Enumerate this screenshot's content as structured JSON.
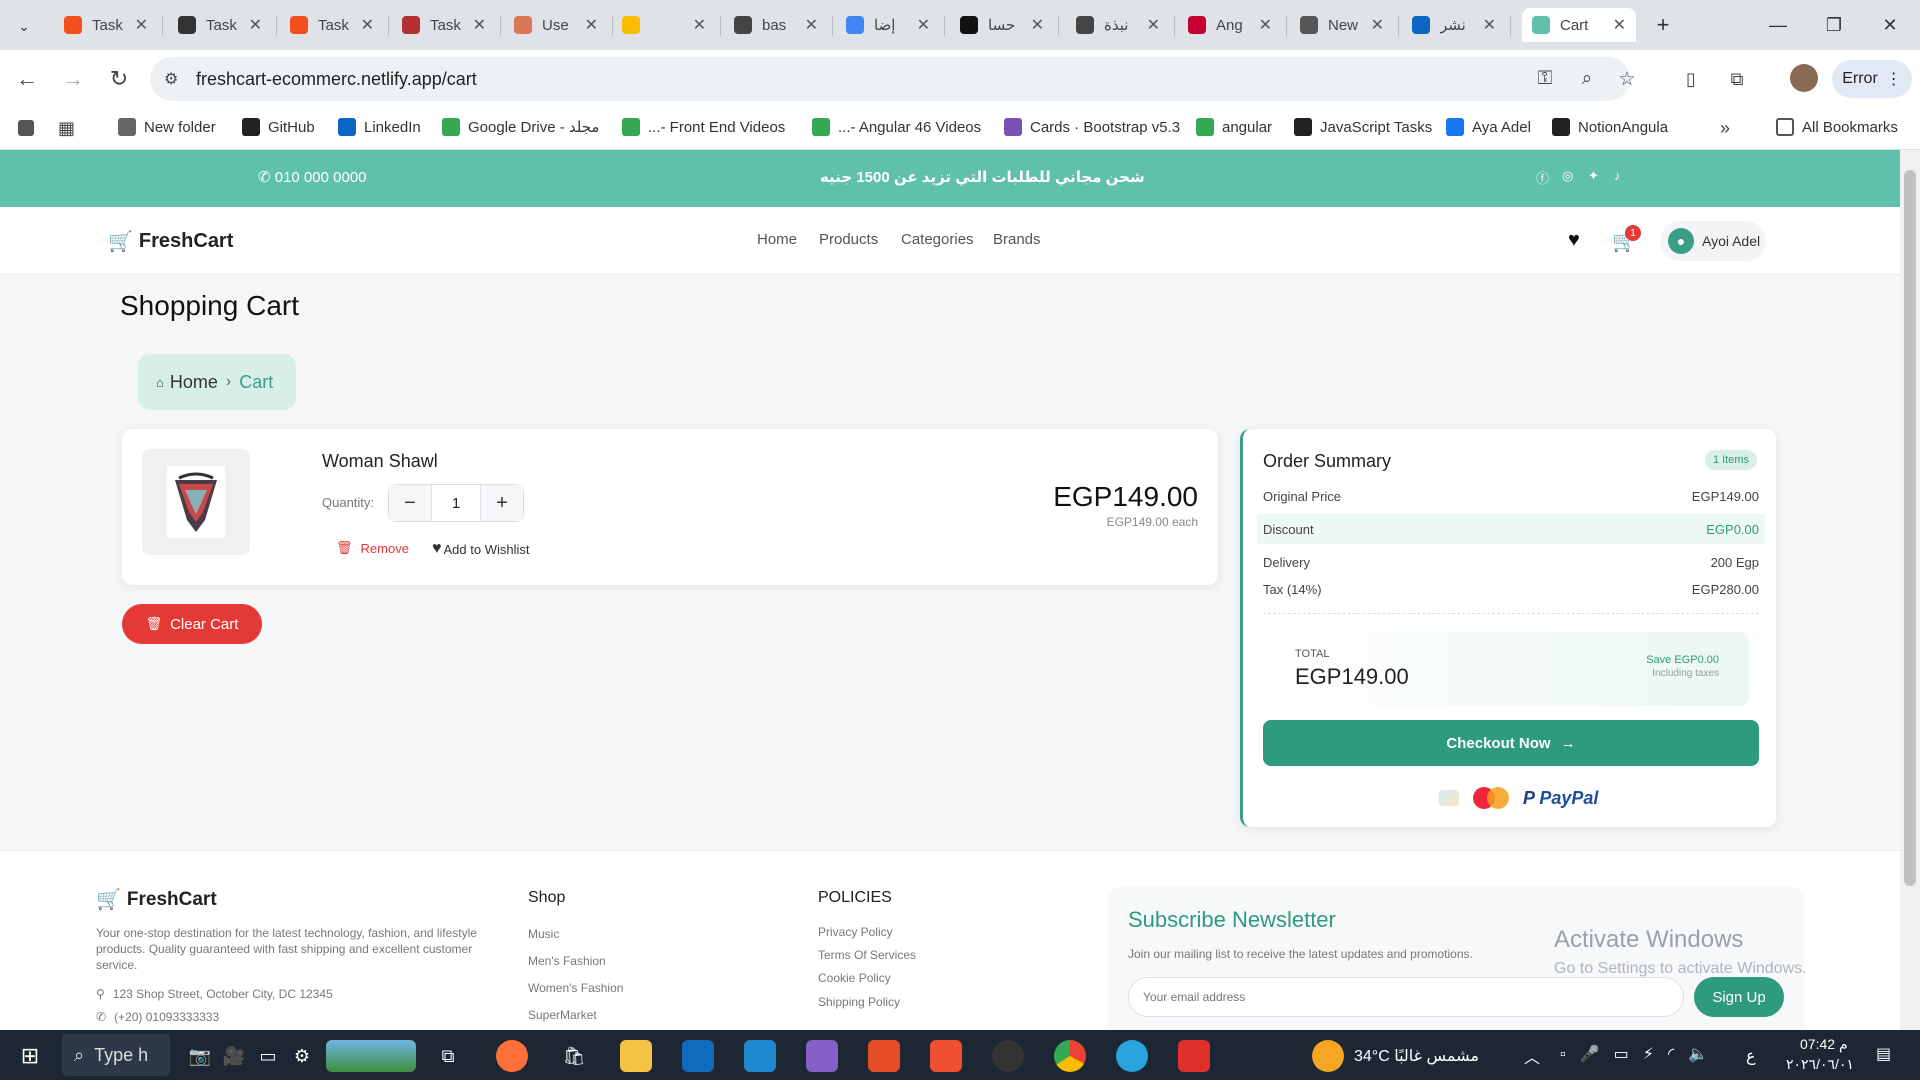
{
  "browser": {
    "tabs": [
      {
        "title": "Task",
        "color": "#f24e1e"
      },
      {
        "title": "Task",
        "color": "#333333"
      },
      {
        "title": "Task",
        "color": "#f24e1e"
      },
      {
        "title": "Task",
        "color": "#b52e31"
      },
      {
        "title": "Use",
        "color": "#d97757"
      },
      {
        "title": "",
        "color": "#fbbc04"
      },
      {
        "title": "bas",
        "color": "#444444"
      },
      {
        "title": "إضا",
        "color": "#4285f4"
      },
      {
        "title": "حسا",
        "color": "#111111"
      },
      {
        "title": "نبذة",
        "color": "#444444"
      },
      {
        "title": "Ang",
        "color": "#c3002f"
      },
      {
        "title": "New",
        "color": "#555555"
      },
      {
        "title": "نشر",
        "color": "#0a66c2"
      },
      {
        "title": "Cart",
        "color": "#5fc0ac"
      }
    ],
    "url": "freshcart-ecommerc.netlify.app/cart",
    "profile_status": "Error",
    "bookmarks": [
      {
        "label": "New folder",
        "color": "#666666"
      },
      {
        "label": "GitHub",
        "color": "#222222"
      },
      {
        "label": "LinkedIn",
        "color": "#0a66c2"
      },
      {
        "label": "Google Drive - مجلد",
        "color": "#34a853"
      },
      {
        "label": "...- Front End Videos",
        "color": "#34a853"
      },
      {
        "label": "...- Angular 46 Videos",
        "color": "#34a853"
      },
      {
        "label": "Cards · Bootstrap v5.3",
        "color": "#7952b3"
      },
      {
        "label": "angular",
        "color": "#34a853"
      },
      {
        "label": "JavaScript Tasks",
        "color": "#222222"
      },
      {
        "label": "Aya Adel",
        "color": "#1877f2"
      },
      {
        "label": "NotionAngula",
        "color": "#222222"
      }
    ],
    "all_bookmarks": "All Bookmarks"
  },
  "promo": {
    "phone": "010 000 0000",
    "message": "شحن مجاني للطلبات التي تزيد عن 1500 جنيه"
  },
  "nav": {
    "brand": "FreshCart",
    "links": [
      "Home",
      "Products",
      "Categories",
      "Brands"
    ],
    "cart_count": "1",
    "user_name": "Ayoi Adel"
  },
  "page": {
    "title": "Shopping Cart",
    "breadcrumb_home": "Home",
    "breadcrumb_current": "Cart"
  },
  "cart_item": {
    "name": "Woman Shawl",
    "quantity_label": "Quantity:",
    "quantity": "1",
    "price": "EGP149.00",
    "each": "EGP149.00 each",
    "remove_label": "Remove",
    "wishlist_label": "Add to Wishlist"
  },
  "clear_cart_label": "Clear Cart",
  "summary": {
    "title": "Order Summary",
    "items_badge": "1 Items",
    "original_price_label": "Original Price",
    "original_price": "EGP149.00",
    "discount_label": "Discount",
    "discount": "EGP0.00",
    "delivery_label": "Delivery",
    "delivery": "200 Egp",
    "tax_label": "Tax (14%)",
    "tax": "EGP280.00",
    "total_label": "TOTAL",
    "total": "EGP149.00",
    "save_label": "Save EGP0.00",
    "tax_note": "Including taxes",
    "checkout_label": "Checkout Now",
    "paypal_label": "PayPal"
  },
  "footer": {
    "brand": "FreshCart",
    "description": "Your one-stop destination for the latest technology, fashion, and lifestyle products. Quality guaranteed with fast shipping and excellent customer service.",
    "address": "123 Shop Street, October City, DC 12345",
    "phone": "(+20) 01093333333",
    "shop_heading": "Shop",
    "shop_links": [
      "Music",
      "Men's Fashion",
      "Women's Fashion",
      "SuperMarket"
    ],
    "policies_heading": "POLICIES",
    "policy_links": [
      "Privacy Policy",
      "Terms Of Services",
      "Cookie Policy",
      "Shipping Policy"
    ],
    "newsletter_title": "Subscribe Newsletter",
    "newsletter_sub": "Join our mailing list to receive the latest updates and promotions.",
    "newsletter_placeholder": "Your email address",
    "newsletter_button": "Sign Up"
  },
  "overlay": {
    "activate_title": "Activate Windows",
    "activate_sub": "Go to Settings to activate Windows."
  },
  "taskbar": {
    "search_text": "Type h",
    "weather": "34°C مشمس غالبًا",
    "lang": "ع",
    "time": "07:42 م",
    "date": "٢٠٢٦/٠٦/٠١"
  }
}
